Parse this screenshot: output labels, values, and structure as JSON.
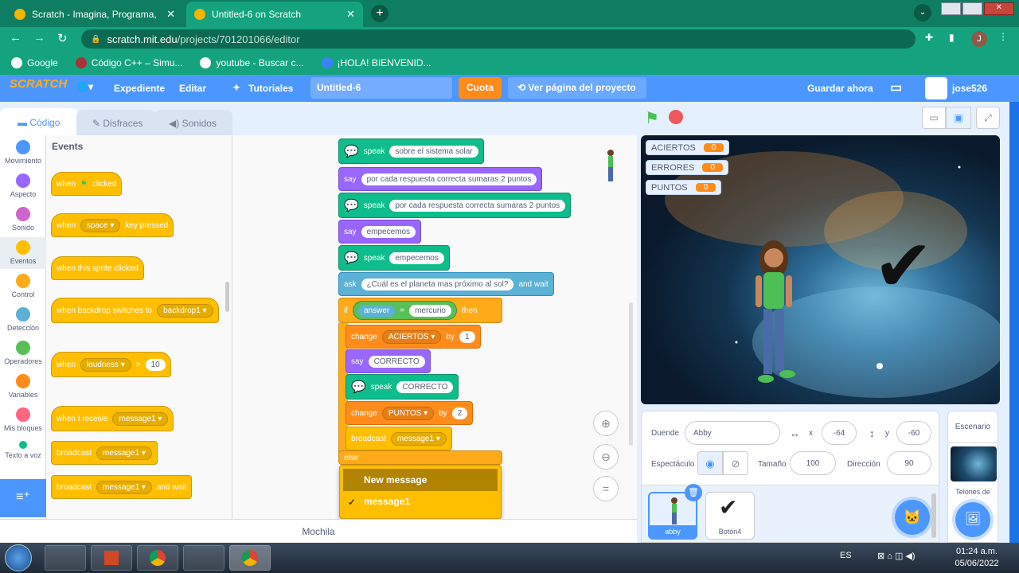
{
  "browser": {
    "tabs": [
      {
        "title": "Scratch - Imagina, Programa, Cor"
      },
      {
        "title": "Untitled-6 on Scratch"
      }
    ],
    "url_host": "scratch.mit.edu",
    "url_path": "/projects/701201066/editor",
    "bookmarks": [
      "Google",
      "Código C++ – Simu...",
      "youtube - Buscar c...",
      "¡HOLA! BIENVENID..."
    ],
    "profile_initial": "J"
  },
  "header": {
    "logo": "SCRATCH",
    "file": "Expediente",
    "edit": "Editar",
    "tutorials": "Tutoriales",
    "project_title": "Untitled-6",
    "share": "Cuota",
    "see_project": "Ver página del proyecto",
    "save": "Guardar ahora",
    "user": "jose526"
  },
  "tabs": {
    "code": "Código",
    "costumes": "Disfraces",
    "sounds": "Sonidos"
  },
  "categories": [
    {
      "label": "Movimiento",
      "color": "#4c97ff"
    },
    {
      "label": "Aspecto",
      "color": "#9966ff"
    },
    {
      "label": "Sonido",
      "color": "#cf63cf"
    },
    {
      "label": "Eventos",
      "color": "#ffbf00"
    },
    {
      "label": "Control",
      "color": "#ffab19"
    },
    {
      "label": "Detección",
      "color": "#5cb1d6"
    },
    {
      "label": "Operadores",
      "color": "#59c059"
    },
    {
      "label": "Variables",
      "color": "#ff8c1a"
    },
    {
      "label": "Mis bloques",
      "color": "#ff6680"
    },
    {
      "label": "Texto a voz",
      "color": "#0fbd8c"
    }
  ],
  "palette": {
    "heading": "Events",
    "when_flag": {
      "a": "when",
      "b": "clicked"
    },
    "when_key": {
      "a": "when",
      "key": "space",
      "b": "key pressed"
    },
    "when_sprite": "when this sprite clicked",
    "when_backdrop": {
      "a": "when backdrop switches to",
      "dd": "backdrop1"
    },
    "when_loud": {
      "a": "when",
      "dd": "loudness",
      "op": ">",
      "val": "10"
    },
    "when_receive": {
      "a": "when I receive",
      "dd": "message1"
    },
    "broadcast": {
      "a": "broadcast",
      "dd": "message1"
    },
    "broadcast_wait": {
      "a": "broadcast",
      "dd": "message1",
      "b": "and wait"
    }
  },
  "script": {
    "s1": {
      "a": "speak",
      "t": "sobre el sistema solar"
    },
    "s2": {
      "a": "say",
      "t": "por cada respuesta correcta sumaras 2 puntos"
    },
    "s3": {
      "a": "speak",
      "t": "por cada respuesta correcta sumaras 2 puntos"
    },
    "s4": {
      "a": "say",
      "t": "empecemos"
    },
    "s5": {
      "a": "speak",
      "t": "empecemos"
    },
    "s6": {
      "a": "ask",
      "t": "¿Cuál es el planeta mas próximo al sol?",
      "b": "and wait"
    },
    "s7": {
      "a": "if",
      "var": "answer",
      "eq": "=",
      "t": "mercurio",
      "b": "then"
    },
    "s8": {
      "a": "change",
      "dd": "ACIERTOS",
      "by": "by",
      "v": "1"
    },
    "s9": {
      "a": "say",
      "t": "CORRECTO"
    },
    "s10": {
      "a": "speak",
      "t": "CORRECTO"
    },
    "s11": {
      "a": "change",
      "dd": "PUNTOS",
      "by": "by",
      "v": "2"
    },
    "s12": {
      "a": "broadcast",
      "dd": "message1"
    },
    "s13": "else"
  },
  "dropdown": {
    "new": "New message",
    "opt": "message1"
  },
  "backpack": "Mochila",
  "stage_monitors": [
    {
      "label": "ACIERTOS",
      "value": "0"
    },
    {
      "label": "ERRORES",
      "value": "0"
    },
    {
      "label": "PUNTOS",
      "value": "0"
    }
  ],
  "sprite_info": {
    "sprite_label": "Duende",
    "name": "Abby",
    "x_label": "x",
    "x": "-64",
    "y_label": "y",
    "y": "-60",
    "show_label": "Espectáculo",
    "size_label": "Tamaño",
    "size": "100",
    "dir_label": "Dirección",
    "dir": "90"
  },
  "sprites": [
    {
      "name": "abby"
    },
    {
      "name": "Botón4"
    }
  ],
  "stage_panel": {
    "title": "Escenario",
    "backdrops": "Telones de fondo"
  },
  "taskbar": {
    "lang": "ES",
    "time": "01:24 a.m.",
    "date": "05/06/2022"
  }
}
